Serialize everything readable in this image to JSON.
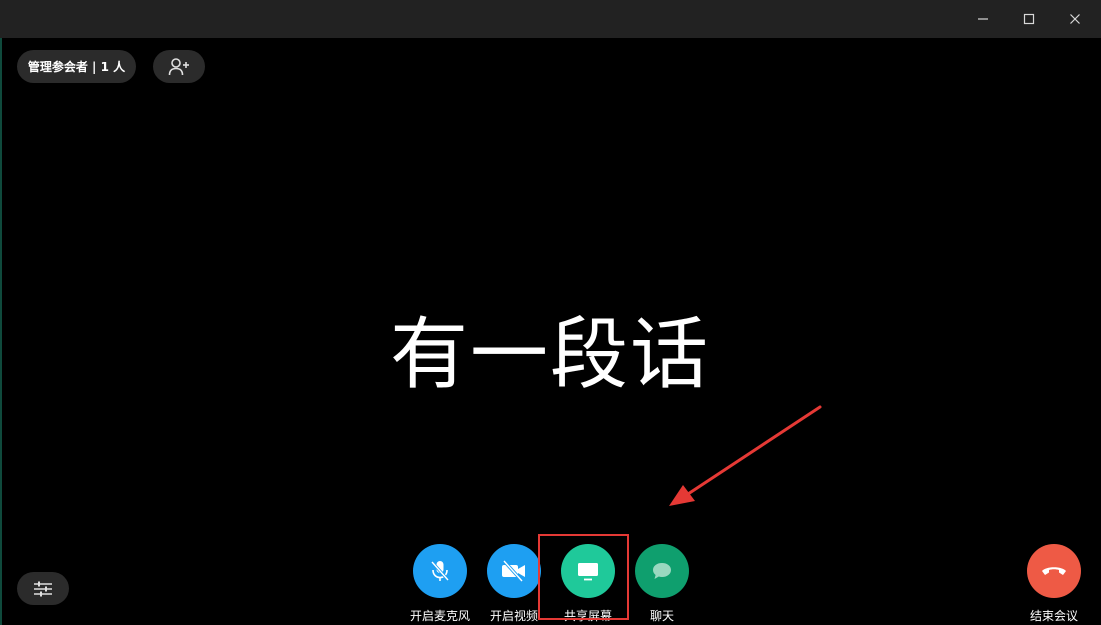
{
  "participants_label": "管理参会者 | 1 人",
  "main_text": "有一段话",
  "window_controls": {
    "minimize_icon": "minimize-icon",
    "maximize_icon": "maximize-icon",
    "close_icon": "close-icon"
  },
  "controls": [
    {
      "label": "开启麦克风",
      "icon": "microphone-off-icon",
      "color": "#1e9ff2"
    },
    {
      "label": "开启视频",
      "icon": "video-off-icon",
      "color": "#1e9ff2"
    },
    {
      "label": "共享屏幕",
      "icon": "monitor-icon",
      "color": "#1fc99a"
    },
    {
      "label": "聊天",
      "icon": "chat-icon",
      "color": "#0f9f6e"
    },
    {
      "label": "结束会议",
      "icon": "phone-hangup-icon",
      "color": "#ee5a45"
    }
  ],
  "colors": {
    "background": "#000000",
    "titlebar": "#222222",
    "pill": "#2b2b2b",
    "highlight": "#e53935"
  }
}
